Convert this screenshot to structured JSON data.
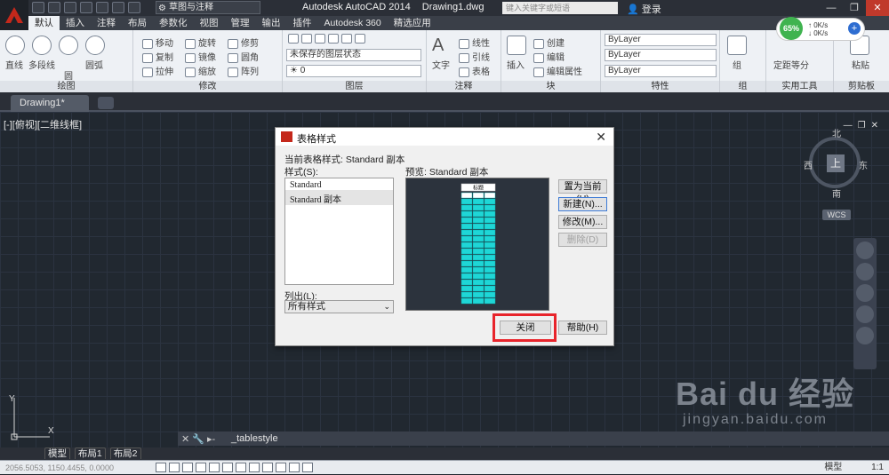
{
  "app": {
    "title": "Autodesk AutoCAD 2014",
    "document": "Drawing1.dwg",
    "workspace": "草图与注释",
    "search_placeholder": "键入关键字或短语",
    "login": "登录",
    "accent": "#c4281b"
  },
  "ribbon_tabs": [
    "默认",
    "插入",
    "注释",
    "布局",
    "参数化",
    "视图",
    "管理",
    "输出",
    "插件",
    "Autodesk 360",
    "精选应用"
  ],
  "ribbon": {
    "draw": {
      "title": "绘图",
      "tools": [
        "直线",
        "多段线",
        "圆",
        "圆弧"
      ]
    },
    "modify": {
      "title": "修改",
      "tools": [
        "移动",
        "旋转",
        "修剪",
        "复制",
        "镜像",
        "圆角",
        "拉伸",
        "缩放",
        "阵列"
      ]
    },
    "layers": {
      "title": "图层",
      "state": "未保存的图层状态",
      "current": "0"
    },
    "annotation": {
      "title": "注释",
      "tools": [
        "文字",
        "线性",
        "引线",
        "表格"
      ]
    },
    "block": {
      "title": "块",
      "tools": [
        "插入",
        "创建",
        "编辑",
        "编辑属性"
      ]
    },
    "properties": {
      "title": "特性",
      "bylayer": "ByLayer"
    },
    "groups": {
      "title": "组",
      "tool": "组"
    },
    "utilities": {
      "title": "实用工具",
      "tool": "定距等分"
    },
    "clipboard": {
      "title": "剪贴板",
      "tool": "粘贴"
    }
  },
  "speed": {
    "percent": "65%",
    "up": "0K/s",
    "down": "0K/s"
  },
  "drawing_tab": "Drawing1*",
  "viewport": {
    "label": "[-][俯视][二维线框]",
    "compass": {
      "center": "上",
      "north": "北",
      "south": "南",
      "east": "东",
      "west": "西"
    },
    "wcs": "WCS",
    "ucs_x": "X",
    "ucs_y": "Y"
  },
  "command_line": "_tablestyle",
  "layout_tabs": [
    "模型",
    "布局1",
    "布局2"
  ],
  "status": {
    "coords": "2056.5053, 1150.4455, 0.0000",
    "model": "模型",
    "scale": "1:1"
  },
  "watermark": {
    "brand": "Bai du 经验",
    "url": "jingyan.baidu.com"
  },
  "dialog": {
    "title": "表格样式",
    "current_style": "当前表格样式: Standard 副本",
    "styles_label": "样式(S):",
    "styles": [
      "Standard",
      "Standard 副本"
    ],
    "selected_style": "Standard 副本",
    "list_label": "列出(L):",
    "list_value": "所有样式",
    "preview_label": "预览: Standard 副本",
    "preview_title": "标题",
    "buttons": {
      "set_current": "置为当前(U)",
      "new": "新建(N)...",
      "modify": "修改(M)...",
      "delete": "删除(D)",
      "close": "关闭",
      "help": "帮助(H)"
    }
  }
}
